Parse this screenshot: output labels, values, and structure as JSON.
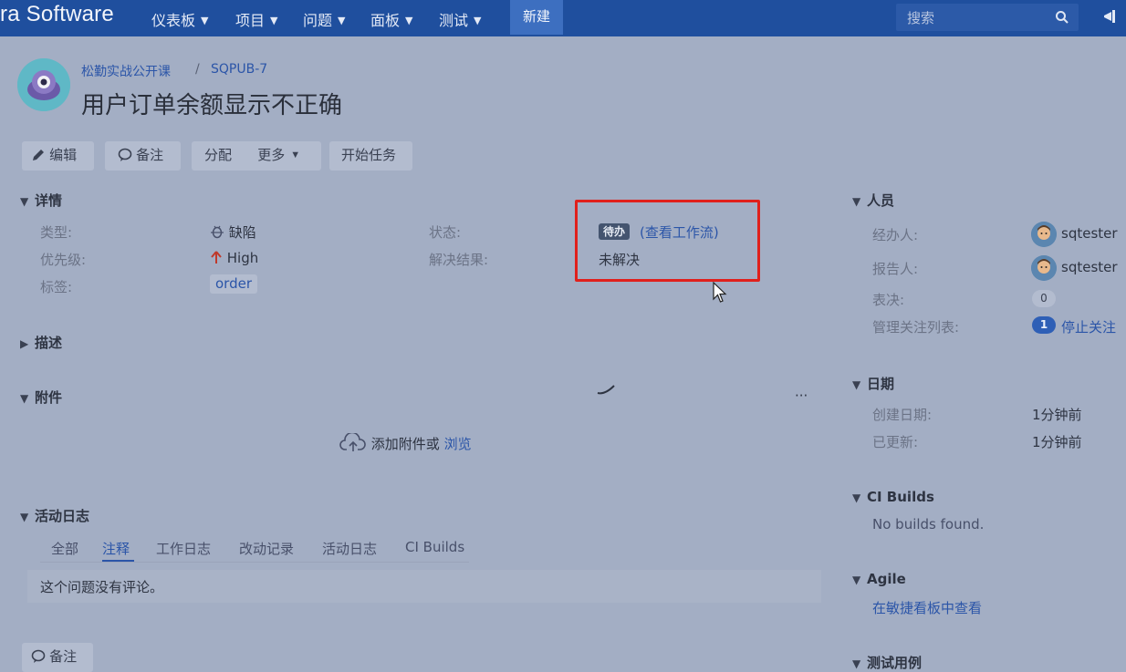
{
  "nav": {
    "brand": "ra Software",
    "items": [
      "仪表板",
      "项目",
      "问题",
      "面板",
      "测试"
    ],
    "create": "新建",
    "search_placeholder": "搜索"
  },
  "header": {
    "project": "松勤实战公开课",
    "separator": "/",
    "issue_key": "SQPUB-7",
    "title": "用户订单余额显示不正确"
  },
  "toolbar": {
    "edit": "编辑",
    "comment": "备注",
    "assign": "分配",
    "more": "更多",
    "start": "开始任务"
  },
  "details": {
    "heading": "详情",
    "type_label": "类型:",
    "type_value": "缺陷",
    "priority_label": "优先级:",
    "priority_value": "High",
    "labels_label": "标签:",
    "labels_value": "order",
    "status_label": "状态:",
    "status_value": "待办",
    "workflow_link": "(查看工作流)",
    "resolution_label": "解决结果:",
    "resolution_value": "未解决"
  },
  "description": {
    "heading": "描述"
  },
  "attachments": {
    "heading": "附件",
    "drop_text": "添加附件或",
    "browse": "浏览",
    "more": "···"
  },
  "activity": {
    "heading": "活动日志",
    "tabs": [
      "全部",
      "注释",
      "工作日志",
      "改动记录",
      "活动日志",
      "CI Builds"
    ],
    "active_tab": "注释",
    "empty": "这个问题没有评论。",
    "comment_button": "备注"
  },
  "people": {
    "heading": "人员",
    "assignee_label": "经办人:",
    "assignee": "sqtester",
    "reporter_label": "报告人:",
    "reporter": "sqtester",
    "votes_label": "表决:",
    "votes": "0",
    "watchers_label": "管理关注列表:",
    "watchers": "1",
    "stop_watching": "停止关注"
  },
  "dates": {
    "heading": "日期",
    "created_label": "创建日期:",
    "created": "1分钟前",
    "updated_label": "已更新:",
    "updated": "1分钟前"
  },
  "ci": {
    "heading": "CI Builds",
    "text": "No builds found."
  },
  "agile": {
    "heading": "Agile",
    "link": "在敏捷看板中查看"
  },
  "tests": {
    "heading": "测试用例"
  },
  "colors": {
    "nav": "#1f4f9e",
    "highlight": "#e0201c",
    "link": "#2b55a8"
  }
}
